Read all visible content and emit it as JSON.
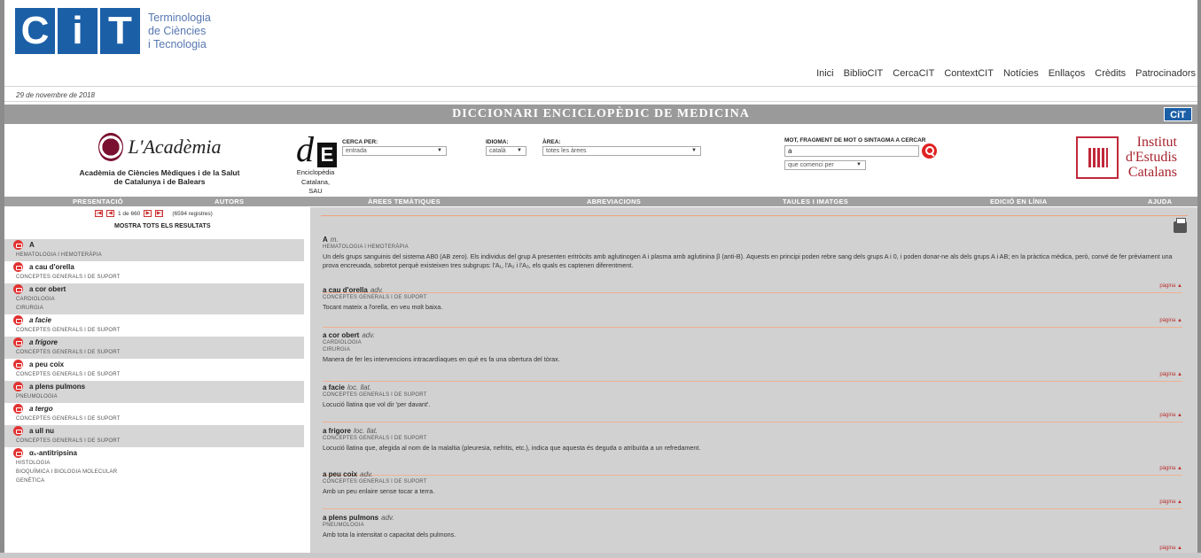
{
  "header": {
    "logo_letters": "CiT",
    "logo_lines": [
      "Terminologia",
      "de Ciències",
      "i Tecnologia"
    ],
    "nav": [
      "Inici",
      "BiblioCIT",
      "CercaCIT",
      "ContextCIT",
      "Notícies",
      "Enllaços",
      "Crèdits",
      "Patrocinadors"
    ]
  },
  "date": "29 de novembre de 2018",
  "title": "DICCIONARI ENCICLOPÈDIC DE MEDICINA",
  "title_badge": "CiT",
  "academia": {
    "script": "L'Acadèmia",
    "name_line1": "Acadèmia de Ciències Mèdiques i de la Salut",
    "name_line2": "de Catalunya i de Balears"
  },
  "enciclopedia": {
    "mark_d": "d",
    "mark_e": "E",
    "line1": "Enciclopèdia",
    "line2": "Catalana,",
    "line3": "SAU"
  },
  "search": {
    "cerca_label": "CERCA PER:",
    "cerca_value": "entrada",
    "idioma_label": "IDIOMA:",
    "idioma_value": "català",
    "area_label": "ÀREA:",
    "area_value": "totes les àrees",
    "term_label": "MOT, FRAGMENT DE MOT O SINTAGMA A CERCAR",
    "term_value": "a",
    "mode_value": "que comenci per"
  },
  "iec": {
    "line1": "Institut",
    "line2": "d'Estudis",
    "line3": "Catalans"
  },
  "menu": [
    "PRESENTACIÓ",
    "AUTORS",
    "ÀREES TEMÀTIQUES",
    "ABREVIACIONS",
    "TAULES I IMATGES",
    "EDICIÓ EN LÍNIA",
    "AJUDA"
  ],
  "pager": {
    "text": "1 de 660",
    "count": "(6594 registres)"
  },
  "show_all": "MOSTRA TOTS ELS RESULTATS",
  "results": [
    {
      "term": "A",
      "italic": false,
      "areas": [
        "HEMATOLOGIA I HEMOTERÀPIA"
      ]
    },
    {
      "term": "a cau d'orella",
      "italic": false,
      "areas": [
        "CONCEPTES GENERALS I DE SUPORT"
      ]
    },
    {
      "term": "a cor obert",
      "italic": false,
      "areas": [
        "CARDIOLOGIA",
        "CIRURGIA"
      ]
    },
    {
      "term": "a facie",
      "italic": true,
      "areas": [
        "CONCEPTES GENERALS I DE SUPORT"
      ]
    },
    {
      "term": "a frigore",
      "italic": true,
      "areas": [
        "CONCEPTES GENERALS I DE SUPORT"
      ]
    },
    {
      "term": "a peu coix",
      "italic": false,
      "areas": [
        "CONCEPTES GENERALS I DE SUPORT"
      ]
    },
    {
      "term": "a plens pulmons",
      "italic": false,
      "areas": [
        "PNEUMOLOGIA"
      ]
    },
    {
      "term": "a tergo",
      "italic": true,
      "areas": [
        "CONCEPTES GENERALS I DE SUPORT"
      ]
    },
    {
      "term": "a ull nu",
      "italic": false,
      "areas": [
        "CONCEPTES GENERALS I DE SUPORT"
      ]
    },
    {
      "term": "α₁-antitripsina",
      "italic": false,
      "areas": [
        "HISTOLOGIA",
        "BIOQUÍMICA I BIOLOGIA MOLECULAR",
        "GENÈTICA"
      ]
    }
  ],
  "entries": [
    {
      "term": "A",
      "gram": "m.",
      "areas": [
        "HEMATOLOGIA I HEMOTERÀPIA"
      ],
      "def": "Un dels grups sanguinis del sistema AB0 (AB zero). Els individus del grup A presenten eritròcits amb aglutinogen A i plasma amb aglutinina β (anti-B). Aquests en principi poden rebre sang dels grups A i 0, i poden donar-ne als dels grups A i AB; en la pràctica mèdica, però, convé de fer prèviament una prova encreuada, sobretot perquè existeixen tres subgrups: l'A₁, l'A₂ i l'A₃, els quals es captenen diferentment."
    },
    {
      "term": "a cau d'orella",
      "gram": "adv.",
      "areas": [
        "CONCEPTES GENERALS I DE SUPORT"
      ],
      "def": "Tocant mateix a l'orella, en veu molt baixa."
    },
    {
      "term": "a cor obert",
      "gram": "adv.",
      "areas": [
        "CARDIOLOGIA",
        "CIRURGIA"
      ],
      "def": "Manera de fer les intervencions intracardíaques en què es fa una obertura del tòrax."
    },
    {
      "term": "a facie",
      "gram": "loc. llat.",
      "areas": [
        "CONCEPTES GENERALS I DE SUPORT"
      ],
      "def": "Locució llatina que vol dir 'per davant'."
    },
    {
      "term": "a frigore",
      "gram": "loc. llat.",
      "areas": [
        "CONCEPTES GENERALS I DE SUPORT"
      ],
      "def": "Locució llatina que, afegida al nom de la malaltia (pleuresia, nefritis, etc.), indica que aquesta és deguda o atribuïda a un refredament."
    },
    {
      "term": "a peu coix",
      "gram": "adv.",
      "areas": [
        "CONCEPTES GENERALS I DE SUPORT"
      ],
      "def": "Amb un peu enlaire sense tocar a terra."
    },
    {
      "term": "a plens pulmons",
      "gram": "adv.",
      "areas": [
        "PNEUMOLOGIA"
      ],
      "def": "Amb tota la intensitat o capacitat dels pulmons."
    }
  ],
  "page_link": "pàgina ▲"
}
